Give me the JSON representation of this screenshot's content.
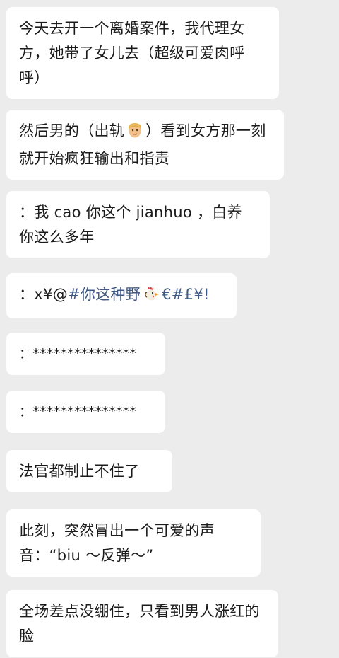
{
  "messages": [
    {
      "text": "今天去开一个离婚案件，我代理女方，她带了女儿去（超级可爱肉呼呼）"
    },
    {
      "before": "然后男的（出轨",
      "emoji": "man-face-emoji",
      "after": "）看到女方那一刻就开始疯狂输出和指责"
    },
    {
      "text": "：我 cao 你这个 jianhuo ，白养你这么多年"
    },
    {
      "prefix": "：x¥@",
      "tag": "#你这种野",
      "emoji": "rooster-emoji",
      "suffix": "€#£¥!"
    },
    {
      "text": "：***************"
    },
    {
      "text": "：***************"
    },
    {
      "text": "法官都制止不住了"
    },
    {
      "text": "此刻，突然冒出一个可爱的声音：“biu ～反弹～”"
    },
    {
      "text": "全场差点没绷住，只看到男人涨红的脸"
    }
  ],
  "colors": {
    "background": "#ececec",
    "bubble": "#ffffff",
    "text": "#1b1b1b",
    "hashtag": "#3f5a86"
  }
}
